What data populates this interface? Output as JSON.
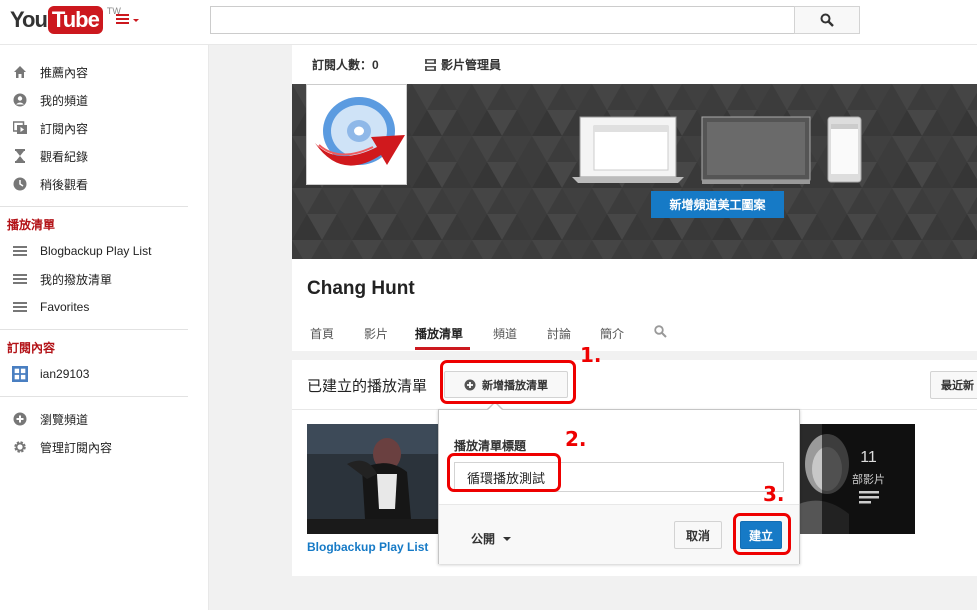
{
  "header": {
    "logo_you": "You",
    "logo_tube": "Tube",
    "logo_region": "TW",
    "search_placeholder": ""
  },
  "sidebar": {
    "main_items": [
      {
        "label": "推薦內容",
        "icon": "home-icon"
      },
      {
        "label": "我的頻道",
        "icon": "person-icon"
      },
      {
        "label": "訂閱內容",
        "icon": "subscriptions-icon"
      },
      {
        "label": "觀看紀錄",
        "icon": "hourglass-icon"
      },
      {
        "label": "稍後觀看",
        "icon": "clock-icon"
      }
    ],
    "playlists_heading": "播放清單",
    "playlists": [
      {
        "label": "Blogbackup Play List",
        "icon": "list-icon"
      },
      {
        "label": "我的撥放清單",
        "icon": "list-icon"
      },
      {
        "label": "Favorites",
        "icon": "list-icon"
      }
    ],
    "subs_heading": "訂閱內容",
    "subscriptions": [
      {
        "label": "ian29103",
        "icon": "channel-avatar-icon"
      }
    ],
    "extra_items": [
      {
        "label": "瀏覽頻道",
        "icon": "plus-circle-icon"
      },
      {
        "label": "管理訂閱內容",
        "icon": "gear-icon"
      }
    ]
  },
  "channel": {
    "subscriber_count": "訂閱人數：0",
    "video_manager": "影片管理員",
    "add_art_button": "新增頻道美工圖案",
    "name": "Chang Hunt",
    "tabs": [
      "首頁",
      "影片",
      "播放清單",
      "頻道",
      "討論",
      "簡介"
    ],
    "active_tab": "播放清單"
  },
  "playlists_section": {
    "title": "已建立的播放清單",
    "new_playlist_button": "新增播放清單",
    "sort_button": "最近新",
    "playlist_link": "Blogbackup Play List",
    "video_count": "11",
    "video_count_label": "部影片"
  },
  "popup": {
    "title_label": "播放清單標題",
    "title_value": "循環播放測試",
    "privacy": "公開",
    "cancel": "取消",
    "create": "建立"
  },
  "annotations": [
    "1.",
    "2.",
    "3."
  ],
  "colors": {
    "brand_red": "#cc181e",
    "accent_blue": "#167ac6",
    "annotation_red": "#ee0000"
  }
}
